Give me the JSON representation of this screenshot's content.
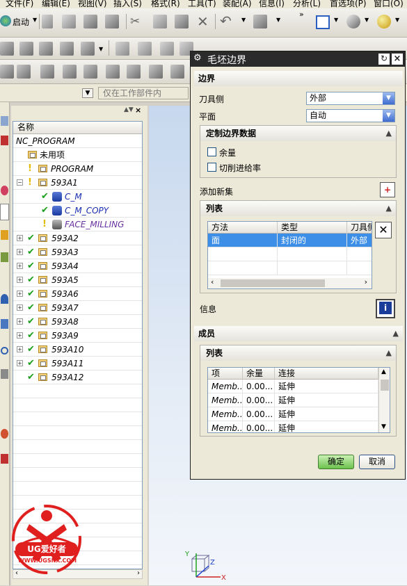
{
  "menu": [
    "文件(F)",
    "编辑(E)",
    "视图(V)",
    "插入(S)",
    "格式(R)",
    "工具(T)",
    "装配(A)",
    "信息(I)",
    "分析(L)",
    "首选项(P)",
    "窗口(O)"
  ],
  "toolbar": {
    "start_label": "启动"
  },
  "filter": {
    "placeholder": "仅在工作部件内"
  },
  "navigator": {
    "column_name": "名称",
    "items": [
      "NC_PROGRAM",
      "未用项",
      "PROGRAM",
      "593A1",
      "C_M",
      "C_M_COPY",
      "FACE_MILLING",
      "593A2",
      "593A3",
      "593A4",
      "593A5",
      "593A6",
      "593A7",
      "593A8",
      "593A9",
      "593A10",
      "593A11",
      "593A12"
    ]
  },
  "dialog": {
    "title": "毛坯边界",
    "boundary_section": "边界",
    "tool_side_label": "刀具侧",
    "tool_side_value": "外部",
    "plane_label": "平面",
    "plane_value": "自动",
    "custom_data_section": "定制边界数据",
    "stock_label": "余量",
    "feedrate_label": "切削进给率",
    "add_new_set_label": "添加新集",
    "list_section": "列表",
    "list_headers": [
      "方法",
      "类型",
      "刀具侧"
    ],
    "list_rows": [
      [
        "面",
        "封闭的",
        "外部"
      ]
    ],
    "info_label": "信息",
    "members_section": "成员",
    "members_list_section": "列表",
    "members_headers": [
      "项",
      "余量",
      "连接"
    ],
    "members_rows": [
      [
        "Memb...",
        "0.00...",
        "延伸"
      ],
      [
        "Memb...",
        "0.00...",
        "延伸"
      ],
      [
        "Memb...",
        "0.00...",
        "延伸"
      ],
      [
        "Memb...",
        "0.00...",
        "延伸"
      ]
    ],
    "ok_label": "确定",
    "cancel_label": "取消"
  },
  "logo": {
    "brand": "UG爱好者",
    "url": "WWW.UGSNX.COM"
  },
  "triad": {
    "x": "X",
    "y": "Y",
    "z": "Z"
  },
  "colors": {
    "selection": "#3d8ee6",
    "ok_button": "#6cc24e",
    "title_bar": "#2b2b2b",
    "logo_red": "#e01f1f"
  }
}
